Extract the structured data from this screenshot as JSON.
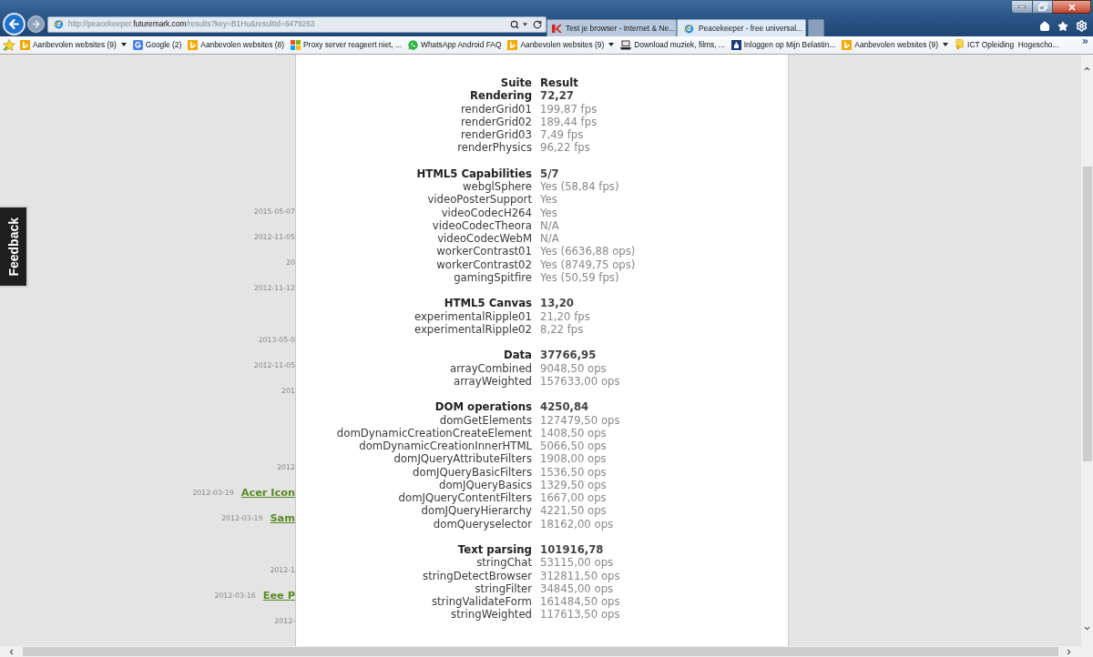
{
  "browser": {
    "address_bar": {
      "url": "http://peacekeeper.**futuremark.com**/results?key=B1Hu&resultId=6479263"
    },
    "tabs": [
      {
        "title": "Test je browser - Internet & Ne...",
        "kind": "site",
        "selected": false
      },
      {
        "title": "Peacekeeper - free universal...",
        "kind": "ie",
        "selected": true
      }
    ],
    "favorites_bar": [
      {
        "label": "Aanbevolen websites (9)",
        "kind": "bing",
        "dropdown": true
      },
      {
        "label": "Google (2)",
        "kind": "google",
        "dropdown": false
      },
      {
        "label": "Aanbevolen websites (8)",
        "kind": "bing",
        "dropdown": false
      },
      {
        "label": "Proxy server reageert niet, ...",
        "kind": "windows",
        "dropdown": false
      },
      {
        "label": "WhatsApp Android FAQ",
        "kind": "whatsapp",
        "dropdown": false
      },
      {
        "label": "Aanbevolen websites (9)",
        "kind": "bing",
        "dropdown": true
      },
      {
        "label": "Download muziek, films, ...",
        "kind": "laptop",
        "dropdown": false
      },
      {
        "label": "Inloggen op Mijn Belastin...",
        "kind": "document",
        "dropdown": false
      },
      {
        "label": "Aanbevolen websites (9)",
        "kind": "bing",
        "dropdown": true
      },
      {
        "label": "ICT Opleiding  Hogescho...",
        "kind": "certificate",
        "dropdown": false
      }
    ]
  },
  "page": {
    "feedback_tab": "Feedback",
    "side_list": [
      {
        "rows": [
          {
            "date": "2015-05-07"
          },
          {
            "date": "2012-11-05"
          },
          {
            "date": "20"
          },
          {
            "date": "2012-11-12"
          }
        ]
      },
      {
        "rows": [
          {
            "date": "2013-05-0"
          },
          {
            "date": "2012-11-05"
          },
          {
            "date": "201"
          }
        ]
      },
      {
        "rows": [
          {
            "date": "2012"
          },
          {
            "date": "2012-03-19",
            "link": "Acer Icon"
          },
          {
            "date": "2012-03-19",
            "link": "Sam"
          }
        ]
      },
      {
        "rows": [
          {
            "date": "2012-1"
          },
          {
            "date": "2012-03-16",
            "link": "Eee P"
          },
          {
            "date": "2012-"
          }
        ]
      }
    ],
    "results": {
      "header": {
        "suite": "Suite",
        "result": "Result"
      },
      "sections": [
        {
          "name": "Rendering",
          "score": "72,27",
          "tests": [
            {
              "name": "renderGrid01",
              "result": "199,87 fps"
            },
            {
              "name": "renderGrid02",
              "result": "189,44 fps"
            },
            {
              "name": "renderGrid03",
              "result": "7,49 fps"
            },
            {
              "name": "renderPhysics",
              "result": "96,22 fps"
            }
          ]
        },
        {
          "name": "HTML5 Capabilities",
          "score": "5/7",
          "tests": [
            {
              "name": "webglSphere",
              "result": "Yes (58,84 fps)"
            },
            {
              "name": "videoPosterSupport",
              "result": "Yes"
            },
            {
              "name": "videoCodecH264",
              "result": "Yes"
            },
            {
              "name": "videoCodecTheora",
              "result": "N/A"
            },
            {
              "name": "videoCodecWebM",
              "result": "N/A"
            },
            {
              "name": "workerContrast01",
              "result": "Yes (6636,88 ops)"
            },
            {
              "name": "workerContrast02",
              "result": "Yes (8749,75 ops)"
            },
            {
              "name": "gamingSpitfire",
              "result": "Yes (50,59 fps)"
            }
          ]
        },
        {
          "name": "HTML5 Canvas",
          "score": "13,20",
          "tests": [
            {
              "name": "experimentalRipple01",
              "result": "21,20 fps"
            },
            {
              "name": "experimentalRipple02",
              "result": "8,22 fps"
            }
          ]
        },
        {
          "name": "Data",
          "score": "37766,95",
          "tests": [
            {
              "name": "arrayCombined",
              "result": "9048,50 ops"
            },
            {
              "name": "arrayWeighted",
              "result": "157633,00 ops"
            }
          ]
        },
        {
          "name": "DOM operations",
          "score": "4250,84",
          "tests": [
            {
              "name": "domGetElements",
              "result": "127479,50 ops"
            },
            {
              "name": "domDynamicCreationCreateElement",
              "result": "1408,50 ops"
            },
            {
              "name": "domDynamicCreationInnerHTML",
              "result": "5066,50 ops"
            },
            {
              "name": "domJQueryAttributeFilters",
              "result": "1908,00 ops"
            },
            {
              "name": "domJQueryBasicFilters",
              "result": "1536,50 ops"
            },
            {
              "name": "domJQueryBasics",
              "result": "1329,50 ops"
            },
            {
              "name": "domJQueryContentFilters",
              "result": "1667,00 ops"
            },
            {
              "name": "domJQueryHierarchy",
              "result": "4221,50 ops"
            },
            {
              "name": "domQueryselector",
              "result": "18162,00 ops"
            }
          ]
        },
        {
          "name": "Text parsing",
          "score": "101916,78",
          "tests": [
            {
              "name": "stringChat",
              "result": "53115,00 ops"
            },
            {
              "name": "stringDetectBrowser",
              "result": "312811,50 ops"
            },
            {
              "name": "stringFilter",
              "result": "34845,00 ops"
            },
            {
              "name": "stringValidateForm",
              "result": "161484,50 ops"
            },
            {
              "name": "stringWeighted",
              "result": "117613,50 ops"
            }
          ]
        }
      ]
    }
  }
}
